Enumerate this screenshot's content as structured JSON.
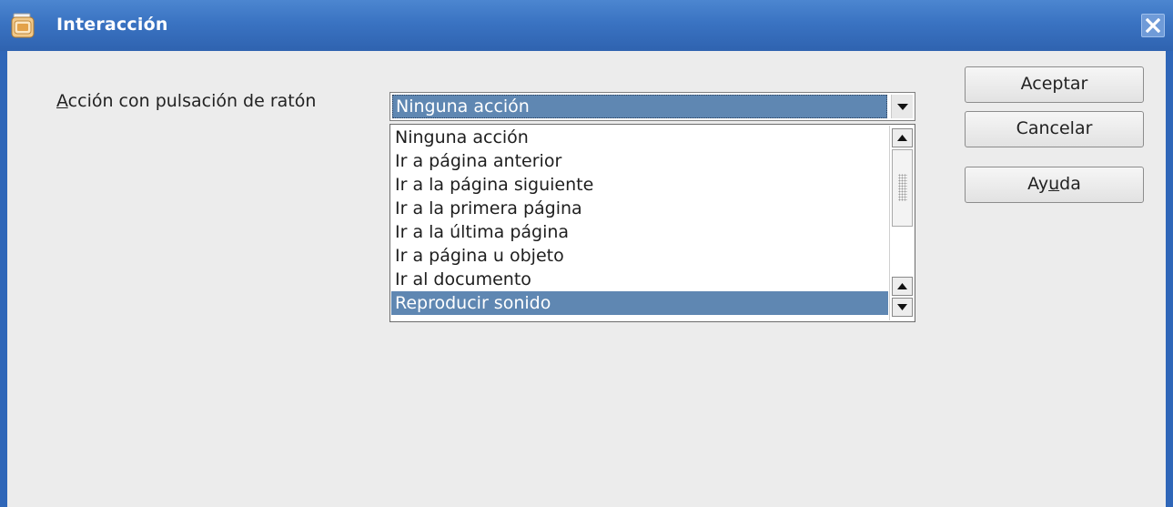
{
  "window": {
    "title": "Interacción",
    "app_icon": "impress-icon",
    "close_icon": "close-icon"
  },
  "form": {
    "label_accel": "A",
    "label_rest": "cción con pulsación de ratón",
    "selected_value": "Ninguna acción",
    "options": [
      "Ninguna acción",
      "Ir a página anterior",
      "Ir a la página siguiente",
      "Ir a la primera página",
      "Ir a la última página",
      "Ir a página u objeto",
      "Ir al documento",
      "Reproducir sonido"
    ],
    "highlighted_option_index": 7
  },
  "buttons": {
    "ok_label": "Aceptar",
    "cancel_label": "Cancelar",
    "help_label_pre": "Ay",
    "help_label_accel": "u",
    "help_label_post": "da"
  },
  "colors": {
    "titlebar": "#3a73c2",
    "selection": "#5f87b2",
    "dialog_bg": "#ececec"
  }
}
